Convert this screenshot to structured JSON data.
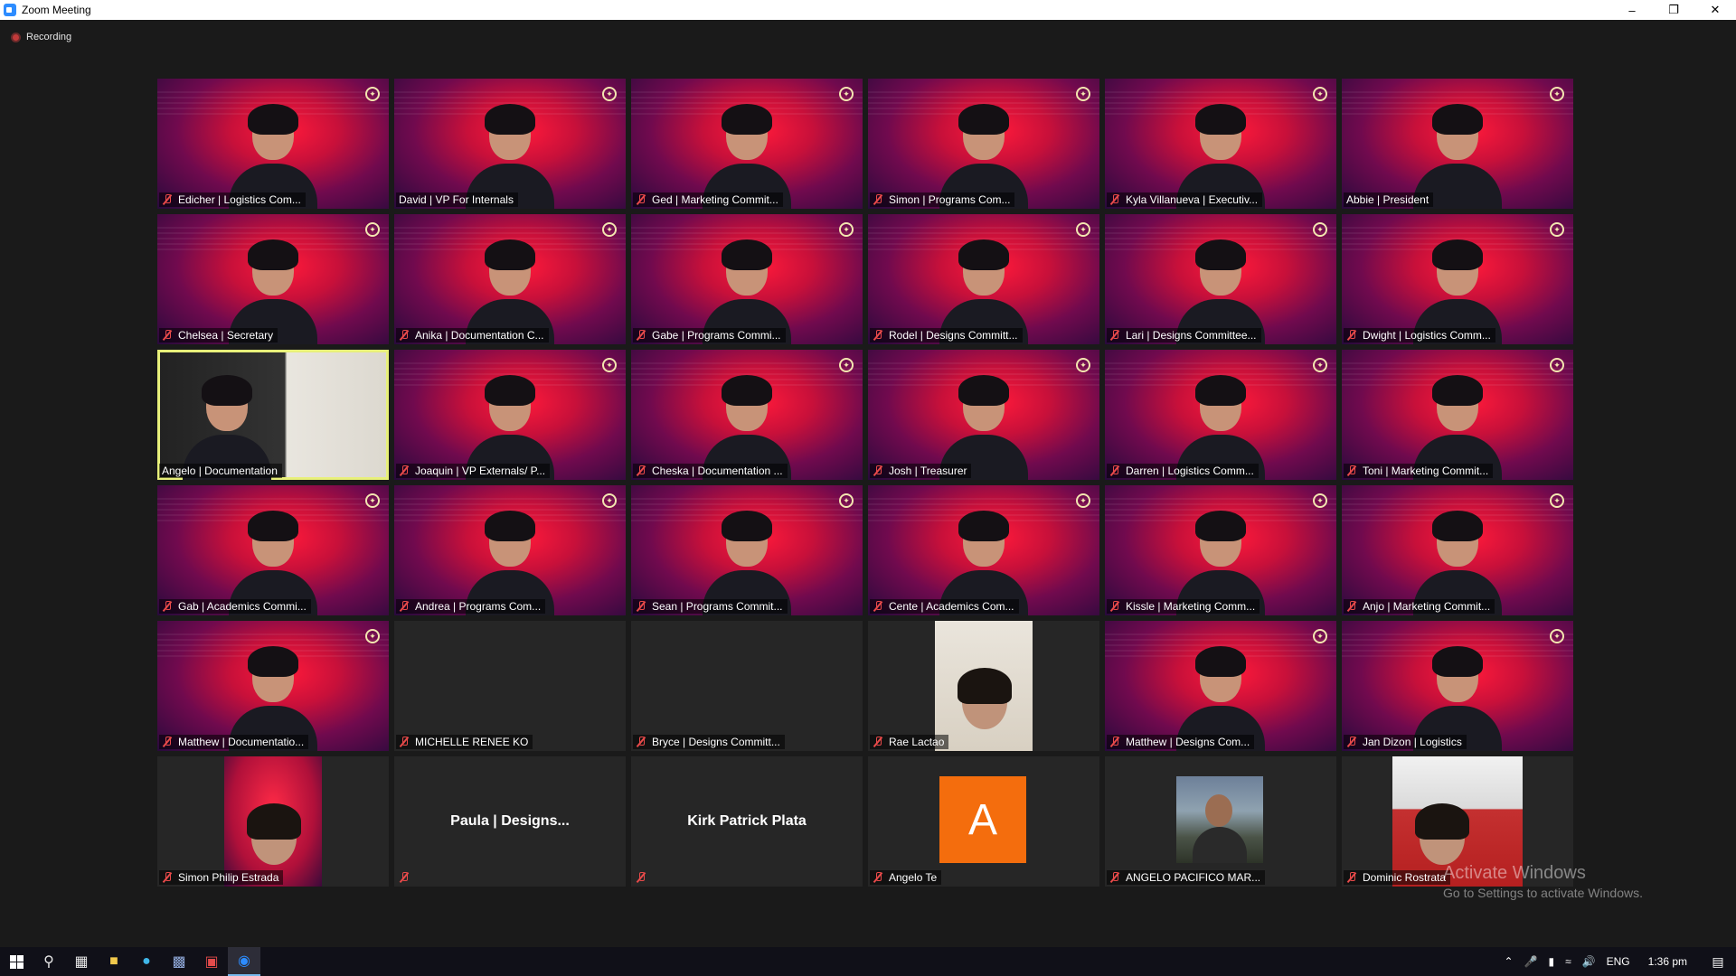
{
  "window": {
    "title": "Zoom Meeting",
    "controls": [
      "–",
      "❐",
      "✕"
    ]
  },
  "recording": {
    "label": "Recording"
  },
  "participants": [
    {
      "name": "Edicher | Logistics Com...",
      "muted": true,
      "video": "red"
    },
    {
      "name": "David | VP For Internals",
      "muted": false,
      "video": "red"
    },
    {
      "name": "Ged | Marketing Commit...",
      "muted": true,
      "video": "red"
    },
    {
      "name": "Simon | Programs Com...",
      "muted": true,
      "video": "red"
    },
    {
      "name": "Kyla Villanueva | Executiv...",
      "muted": true,
      "video": "red"
    },
    {
      "name": "Abbie | President",
      "muted": false,
      "video": "red"
    },
    {
      "name": "Chelsea | Secretary",
      "muted": true,
      "video": "red"
    },
    {
      "name": "Anika | Documentation C...",
      "muted": true,
      "video": "red"
    },
    {
      "name": "Gabe | Programs Commi...",
      "muted": true,
      "video": "red"
    },
    {
      "name": "Rodel | Designs Committ...",
      "muted": true,
      "video": "red"
    },
    {
      "name": "Lari | Designs Committee...",
      "muted": true,
      "video": "red"
    },
    {
      "name": "Dwight | Logistics Comm...",
      "muted": true,
      "video": "red"
    },
    {
      "name": "Angelo | Documentation",
      "muted": false,
      "video": "room",
      "active": true
    },
    {
      "name": "Joaquin | VP Externals/ P...",
      "muted": true,
      "video": "red"
    },
    {
      "name": "Cheska | Documentation ...",
      "muted": true,
      "video": "red"
    },
    {
      "name": "Josh | Treasurer",
      "muted": true,
      "video": "red"
    },
    {
      "name": "Darren | Logistics Comm...",
      "muted": true,
      "video": "red"
    },
    {
      "name": "Toni | Marketing Commit...",
      "muted": true,
      "video": "red"
    },
    {
      "name": "Gab | Academics Commi...",
      "muted": true,
      "video": "red"
    },
    {
      "name": "Andrea | Programs Com...",
      "muted": true,
      "video": "red"
    },
    {
      "name": "Sean | Programs Commit...",
      "muted": true,
      "video": "red"
    },
    {
      "name": "Cente | Academics Com...",
      "muted": true,
      "video": "red"
    },
    {
      "name": "Kissle | Marketing Comm...",
      "muted": true,
      "video": "red"
    },
    {
      "name": "Anjo | Marketing Commit...",
      "muted": true,
      "video": "red"
    },
    {
      "name": "Matthew | Documentatio...",
      "muted": true,
      "video": "red"
    },
    {
      "name": "MICHELLE RENEE KO",
      "muted": true,
      "video": "off"
    },
    {
      "name": "Bryce | Designs Committ...",
      "muted": true,
      "video": "off"
    },
    {
      "name": "Rae Lactao",
      "muted": true,
      "video": "portrait"
    },
    {
      "name": "Matthew | Designs Com...",
      "muted": true,
      "video": "red"
    },
    {
      "name": "Jan Dizon | Logistics",
      "muted": true,
      "video": "red"
    },
    {
      "name": "Simon Philip Estrada",
      "muted": true,
      "video": "portrait-red"
    },
    {
      "name": "",
      "center_name": "Paula | Designs...",
      "muted": true,
      "video": "off"
    },
    {
      "name": "",
      "center_name": "Kirk Patrick Plata",
      "muted": true,
      "video": "off"
    },
    {
      "name": "Angelo Te",
      "muted": true,
      "video": "letter",
      "letter": "A"
    },
    {
      "name": "ANGELO PACIFICO MAR...",
      "muted": true,
      "video": "photo"
    },
    {
      "name": "Dominic Rostrata",
      "muted": true,
      "video": "portrait-cake"
    }
  ],
  "watermark": {
    "title": "Activate Windows",
    "subtitle": "Go to Settings to activate Windows."
  },
  "taskbar": {
    "language": "ENG",
    "time": "1:36 pm"
  },
  "colors": {
    "active_speaker_border": "#e8f07a",
    "letter_avatar_bg": "#f46d0d",
    "mute_icon": "#e84a4a"
  }
}
